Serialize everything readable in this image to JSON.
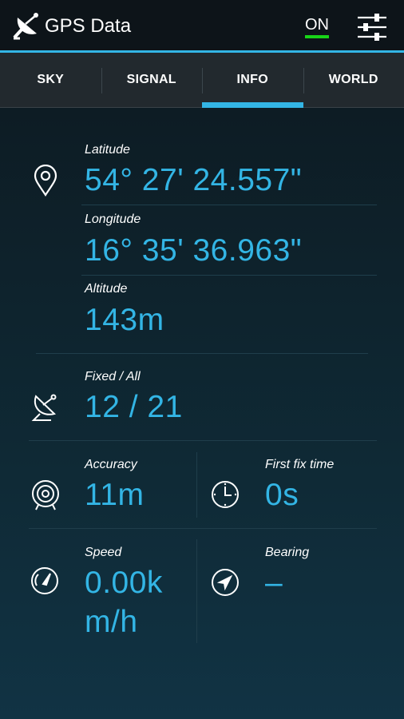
{
  "app": {
    "title": "GPS Data",
    "toggle_label": "ON",
    "accent": "#33b5e5",
    "toggle_color": "#18d418"
  },
  "tabs": [
    {
      "label": "SKY",
      "active": false
    },
    {
      "label": "SIGNAL",
      "active": false
    },
    {
      "label": "INFO",
      "active": true
    },
    {
      "label": "WORLD",
      "active": false
    }
  ],
  "location": {
    "latitude_label": "Latitude",
    "latitude": "54° 27' 24.557\"",
    "longitude_label": "Longitude",
    "longitude": "16° 35' 36.963\"",
    "altitude_label": "Altitude",
    "altitude": "143m"
  },
  "satellites": {
    "label": "Fixed / All",
    "value": "12 / 21"
  },
  "accuracy": {
    "label": "Accuracy",
    "value": "11m"
  },
  "first_fix": {
    "label": "First fix time",
    "value": "0s"
  },
  "speed": {
    "label": "Speed",
    "value_line1": "0.00k",
    "value_line2": "m/h"
  },
  "bearing": {
    "label": "Bearing",
    "value": "–"
  },
  "icons": {
    "logo": "satellite-dish-icon",
    "settings": "sliders-icon",
    "location": "map-pin-icon",
    "satellites": "satellite-dish-icon",
    "accuracy": "target-icon",
    "first_fix": "clock-icon",
    "speed": "speedometer-icon",
    "bearing": "compass-arrow-icon"
  }
}
